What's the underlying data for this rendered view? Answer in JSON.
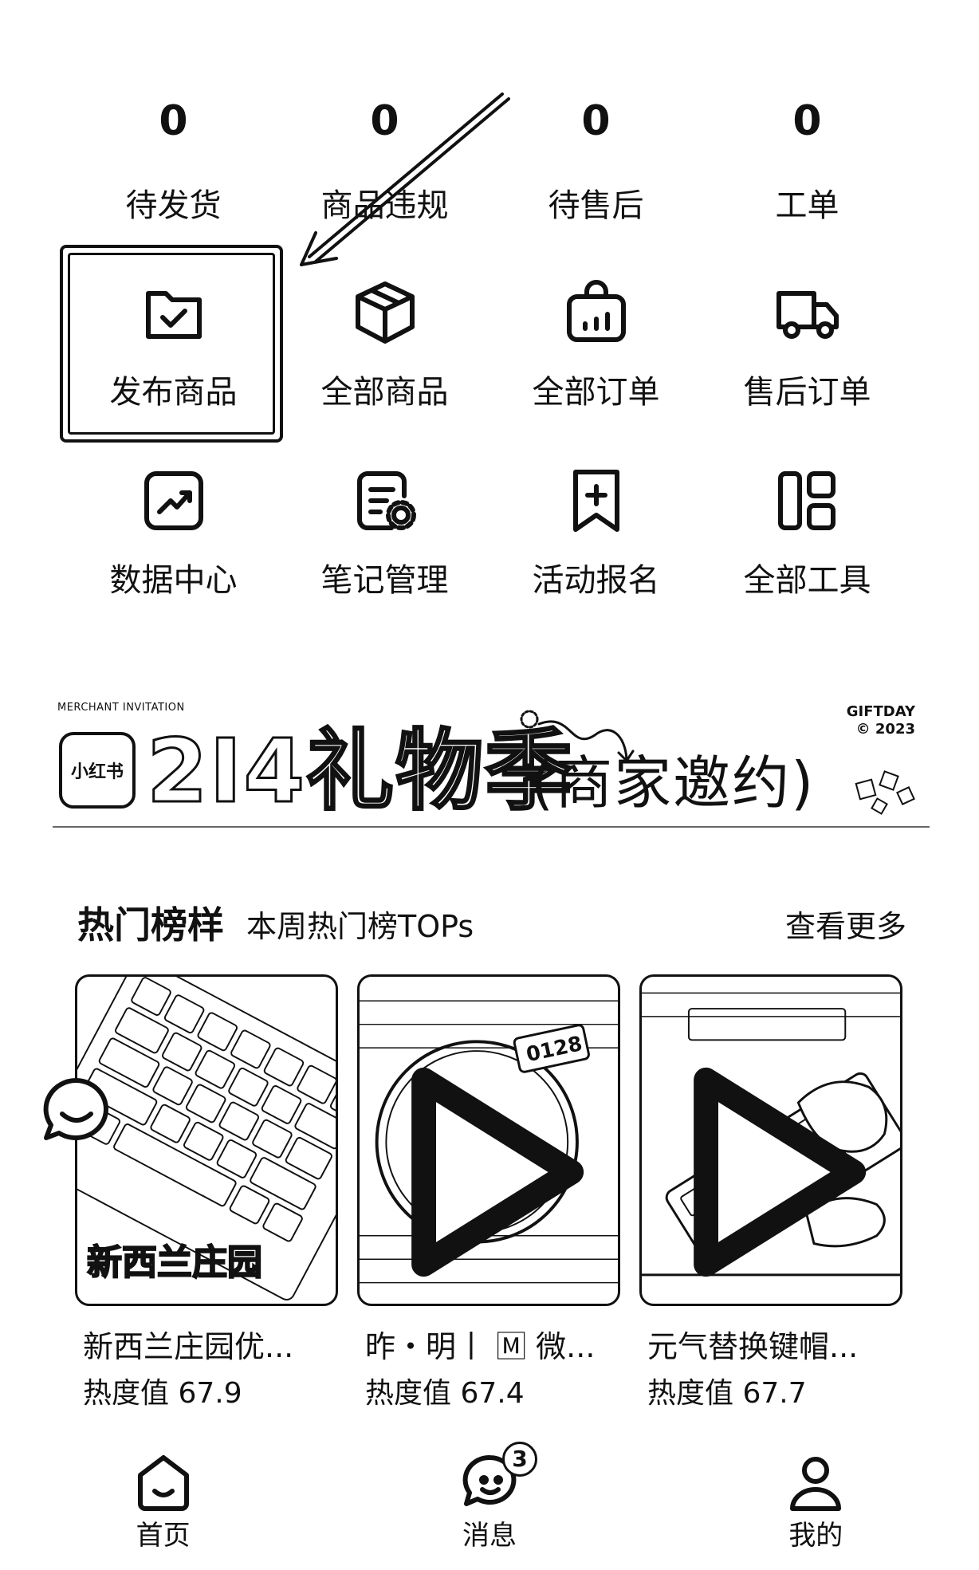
{
  "stats": [
    {
      "value": "0",
      "label": "待发货"
    },
    {
      "value": "0",
      "label": "商品违规"
    },
    {
      "value": "0",
      "label": "待售后"
    },
    {
      "value": "0",
      "label": "工单"
    }
  ],
  "tools": [
    {
      "label": "发布商品",
      "icon": "folder-check-icon"
    },
    {
      "label": "全部商品",
      "icon": "box-icon"
    },
    {
      "label": "全部订单",
      "icon": "bag-chart-icon"
    },
    {
      "label": "售后订单",
      "icon": "truck-icon"
    },
    {
      "label": "数据中心",
      "icon": "trend-chart-icon"
    },
    {
      "label": "笔记管理",
      "icon": "note-settings-icon"
    },
    {
      "label": "活动报名",
      "icon": "bookmark-plus-icon"
    },
    {
      "label": "全部工具",
      "icon": "grid-tools-icon"
    }
  ],
  "banner": {
    "subtitle": "MERCHANT INVITATION",
    "logo_text": "小红书",
    "title": "2I4礼物季",
    "title_suffix": "(商家邀约)",
    "brand_line1": "GIFTDAY",
    "brand_line2": "© 2023"
  },
  "hot": {
    "title": "热门榜样",
    "subtitle": "本周热门榜TOPs",
    "more": "查看更多",
    "items": [
      {
        "title": "新西兰庄园优...",
        "heat": "热度值 67.9",
        "overlay": "新西兰庄园"
      },
      {
        "title": "昨・明丨 🄼 微...",
        "heat": "热度值 67.4",
        "overlay": ""
      },
      {
        "title": "元气替换键帽...",
        "heat": "热度值 67.7",
        "overlay": ""
      }
    ]
  },
  "nav": {
    "items": [
      {
        "label": "首页",
        "icon": "home-icon"
      },
      {
        "label": "消息",
        "icon": "message-icon",
        "badge": "3"
      },
      {
        "label": "我的",
        "icon": "user-icon"
      }
    ]
  }
}
